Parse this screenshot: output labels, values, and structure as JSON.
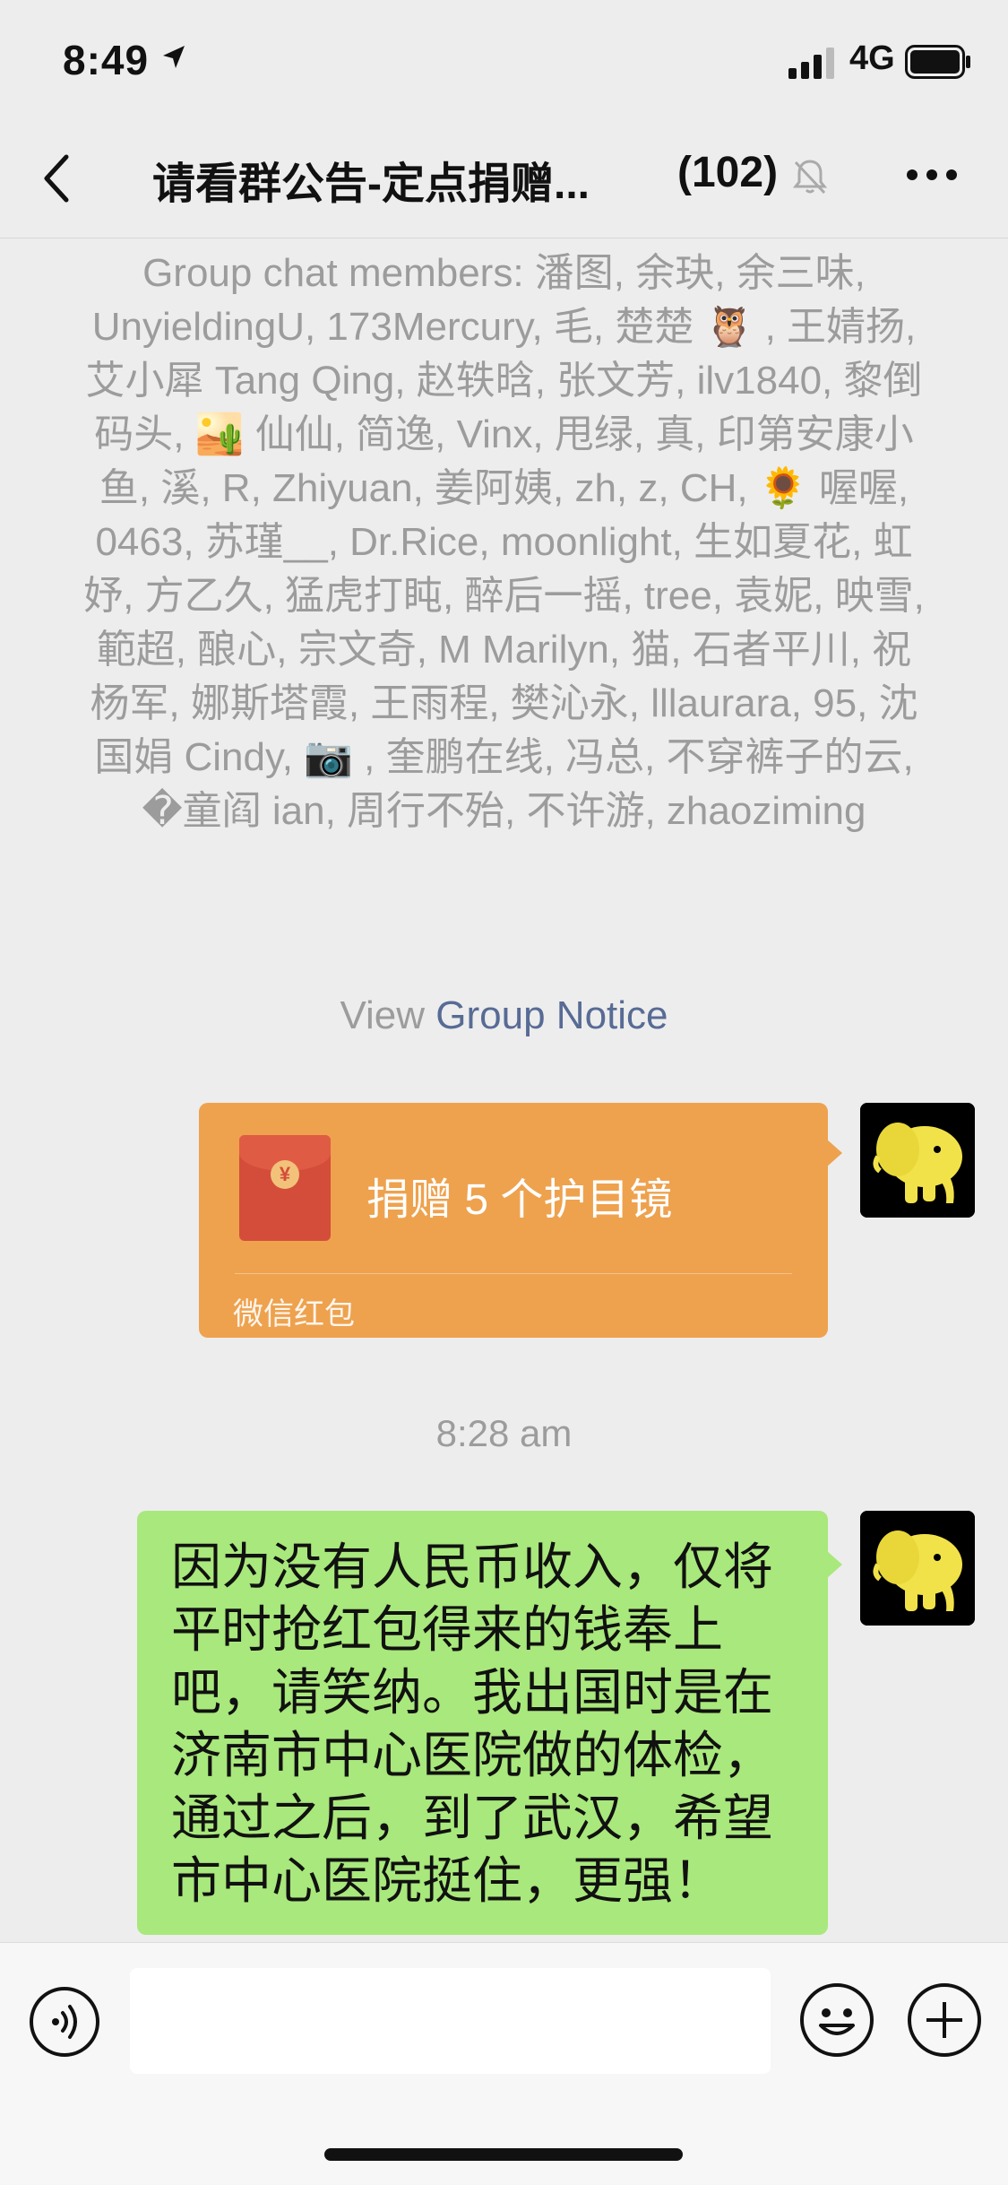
{
  "status_bar": {
    "time": "8:49",
    "network": "4G"
  },
  "nav": {
    "title": "请看群公告-定点捐赠...",
    "member_count": "(102)"
  },
  "system_message": {
    "text": "Group chat members: 潘图, 余玦, 余三味, UnyieldingU, 173Mercury, 毛, 楚楚 🦉 , 王婧扬, 艾小犀 Tang Qing, 赵轶晗, 张文芳, ilv1840, 黎倒码头, 🏜️ 仙仙, 简逸, Vinx, 甩绿, 真, 印第安康小鱼, 溪, R, Zhiyuan, 姜阿姨, zh, z, CH, 🌻 喔喔, 0463, 苏瑾__, Dr.Rice, moonlight, 生如夏花, 虹妤, 方乙久, 猛虎打盹, 醉后一摇, tree, 袁妮, 映雪, 範超, 酿心, 宗文奇, M Marilyn, 猫, 石者平川, 祝杨军, 娜斯塔霞, 王雨程, 樊沁永, lllaurara, 95, 沈国娟 Cindy, 📷 , 奎鹏在线, 冯总, 不穿裤子的云, �童阎 ian, 周行不殆, 不许游, zhaoziming",
    "view_prefix": "View",
    "view_link": "Group Notice"
  },
  "messages": [
    {
      "type": "red_packet",
      "title": "捐赠 5 个护目镜",
      "label": "微信红包",
      "coin": "¥"
    },
    {
      "type": "timestamp",
      "text": "8:28 am"
    },
    {
      "type": "text",
      "text": "因为没有人民币收入，仅将平时抢红包得来的钱奉上吧，请笑纳。我出国时是在济南市中心医院做的体检，通过之后，到了武汉，希望市中心医院挺住，更强！"
    }
  ],
  "colors": {
    "background": "#ededed",
    "bubble_green": "#a9e87c",
    "red_packet": "#eea24e",
    "link": "#576b95",
    "system_text": "#9c9c9c"
  },
  "icons": {
    "back": "chevron-left-icon",
    "mute": "bell-slash-icon",
    "more": "ellipsis-icon",
    "voice": "voice-icon",
    "emoji": "emoji-icon",
    "plus": "plus-icon"
  }
}
